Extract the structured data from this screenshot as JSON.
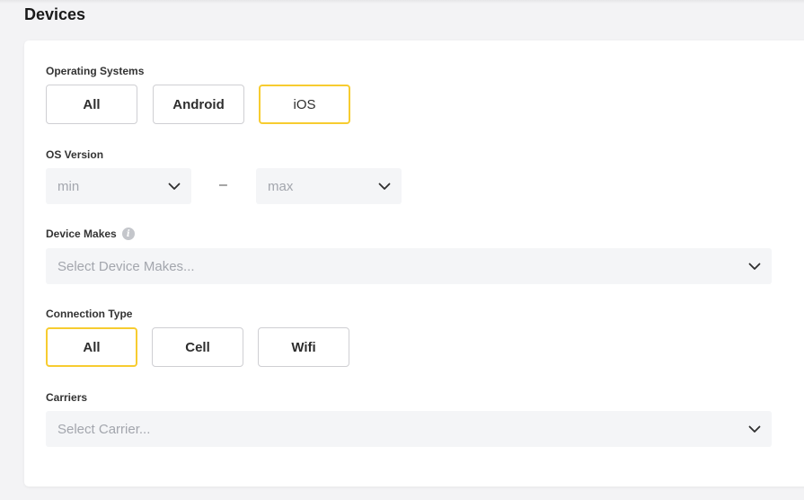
{
  "section": {
    "title": "Devices"
  },
  "operating_systems": {
    "label": "Operating Systems",
    "options": [
      "All",
      "Android",
      "iOS"
    ],
    "selected": "iOS"
  },
  "os_version": {
    "label": "OS Version",
    "min_placeholder": "min",
    "separator": "–",
    "max_placeholder": "max"
  },
  "device_makes": {
    "label": "Device Makes",
    "info_icon": "info-icon",
    "placeholder": "Select Device Makes..."
  },
  "connection_type": {
    "label": "Connection Type",
    "options": [
      "All",
      "Cell",
      "Wifi"
    ],
    "selected": "All"
  },
  "carriers": {
    "label": "Carriers",
    "placeholder": "Select Carrier..."
  },
  "colors": {
    "accent": "#f7cc30",
    "background": "#f3f3f5",
    "field": "#f4f5f7",
    "border": "#cfcfd3",
    "placeholder": "#a3a6ad"
  }
}
